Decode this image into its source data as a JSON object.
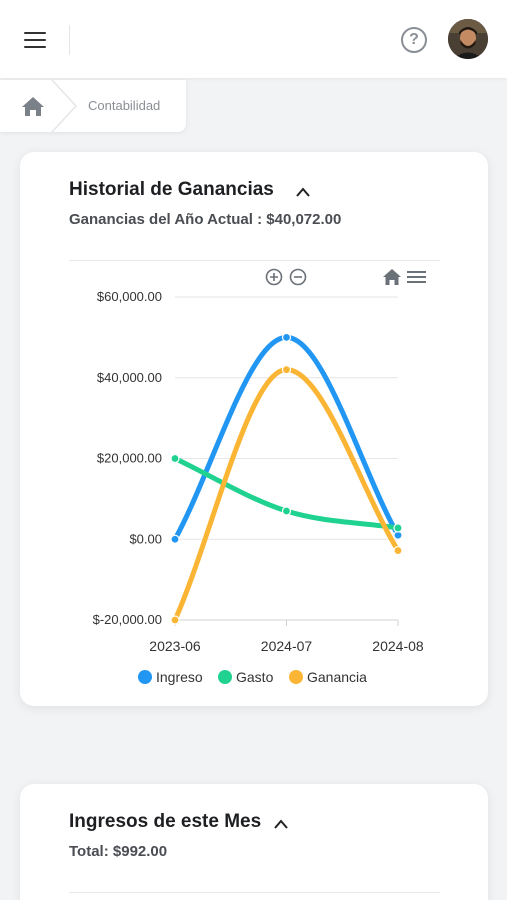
{
  "header": {
    "menu_icon": "hamburger-menu-icon",
    "help_icon": "question-circle-icon",
    "help_glyph": "?",
    "avatar_icon": "user-avatar"
  },
  "breadcrumb": {
    "home_icon": "home-icon",
    "current": "Contabilidad"
  },
  "card_ganancias": {
    "title": "Historial de Ganancias",
    "toggle_icon": "chevron-up-icon",
    "subtitle": "Ganancias del Año Actual : $40,072.00"
  },
  "chart_toolbar": {
    "zoom_in_icon": "zoom-in-icon",
    "zoom_out_icon": "zoom-out-icon",
    "reset_icon": "home-icon",
    "menu_icon": "menu-icon"
  },
  "chart_data": {
    "type": "line",
    "curve": "smooth",
    "categories": [
      "2023-06",
      "2024-07",
      "2024-08"
    ],
    "y_ticks": [
      "$-20,000.00",
      "$0.00",
      "$20,000.00",
      "$40,000.00",
      "$60,000.00"
    ],
    "ylim": [
      -20000,
      60000
    ],
    "grid": true,
    "legend_position": "bottom",
    "series": [
      {
        "name": "Ingreso",
        "color": "#2196f3",
        "values": [
          0,
          50000,
          1000
        ]
      },
      {
        "name": "Gasto",
        "color": "#1fd28f",
        "values": [
          20000,
          7000,
          2800
        ]
      },
      {
        "name": "Ganancia",
        "color": "#fbb534",
        "values": [
          -20000,
          42000,
          -2800
        ]
      }
    ]
  },
  "card_ingresos": {
    "title": "Ingresos de este Mes",
    "toggle_icon": "chevron-up-icon",
    "subtitle": "Total: $992.00"
  }
}
